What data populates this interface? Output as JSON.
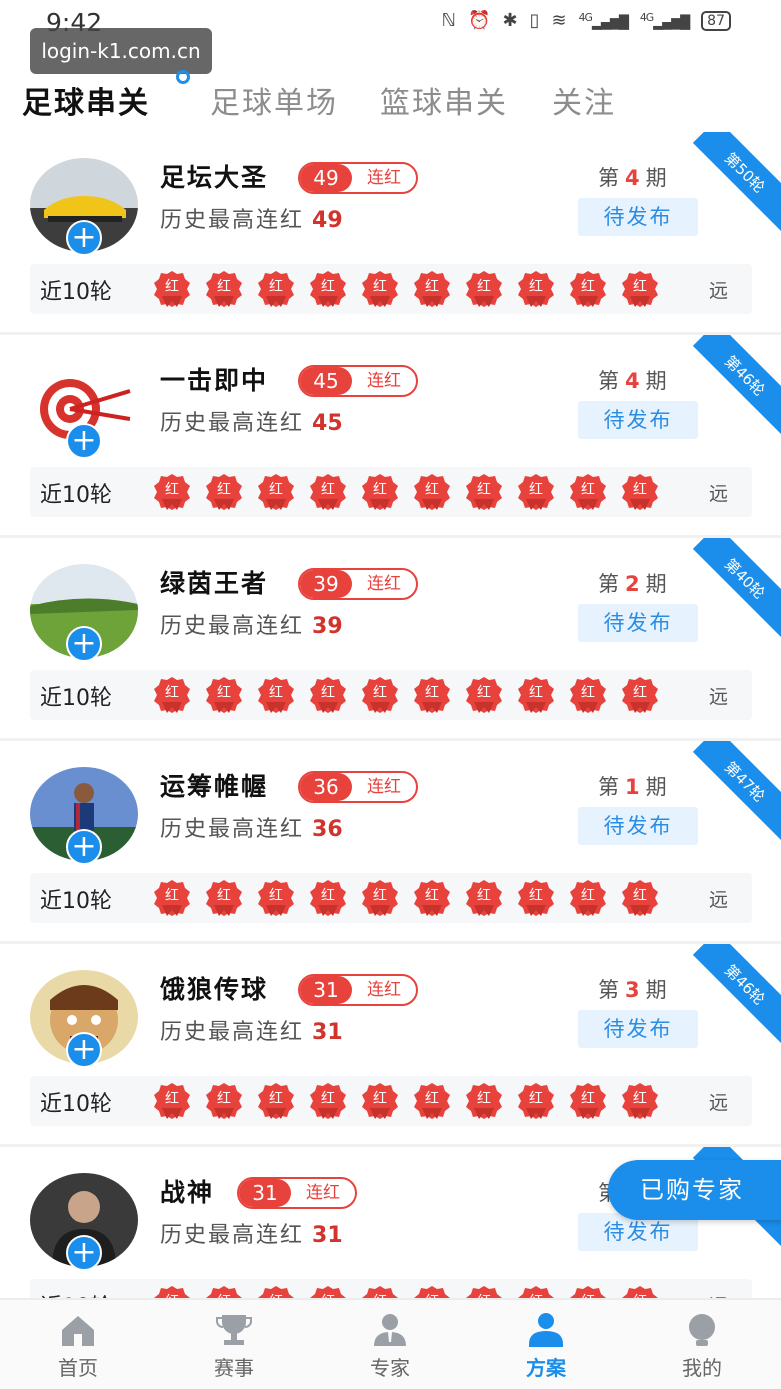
{
  "status_bar": {
    "time": "9:42",
    "battery": "87",
    "net1": "4G",
    "net2": "4G"
  },
  "watermark": "login-k1.com.cn",
  "tabs": [
    {
      "label": "足球串关",
      "active": true
    },
    {
      "label": "足球单场",
      "active": false
    },
    {
      "label": "篮球串关",
      "active": false
    },
    {
      "label": "关注",
      "active": false
    }
  ],
  "card_labels": {
    "history_prefix": "历史最高连红",
    "streak_suffix": "连红",
    "issue_prefix": "第",
    "issue_suffix": "期",
    "pending": "待发布",
    "recent_label": "近10轮",
    "badge_text": "红",
    "far_label": "远"
  },
  "experts": [
    {
      "name": "足坛大圣",
      "streak": "49",
      "history": "49",
      "issue": "4",
      "round": "第50轮",
      "avatar": "car-avatar"
    },
    {
      "name": "一击即中",
      "streak": "45",
      "history": "45",
      "issue": "4",
      "round": "第46轮",
      "avatar": "target-avatar"
    },
    {
      "name": "绿茵王者",
      "streak": "39",
      "history": "39",
      "issue": "2",
      "round": "第40轮",
      "avatar": "grassland-avatar"
    },
    {
      "name": "运筹帷幄",
      "streak": "36",
      "history": "36",
      "issue": "1",
      "round": "第47轮",
      "avatar": "player-avatar"
    },
    {
      "name": "饿狼传球",
      "streak": "31",
      "history": "31",
      "issue": "3",
      "round": "第46轮",
      "avatar": "face-avatar"
    },
    {
      "name": "战神",
      "streak": "31",
      "history": "31",
      "issue": "",
      "round": "",
      "avatar": "man-avatar"
    }
  ],
  "float_button": "已购专家",
  "bottom_nav": [
    {
      "label": "首页",
      "icon": "home-icon",
      "active": false
    },
    {
      "label": "赛事",
      "icon": "trophy-icon",
      "active": false
    },
    {
      "label": "专家",
      "icon": "expert-icon",
      "active": false
    },
    {
      "label": "方案",
      "icon": "plan-icon",
      "active": true
    },
    {
      "label": "我的",
      "icon": "profile-icon",
      "active": false
    }
  ],
  "colors": {
    "accent": "#1a8eea",
    "red": "#e8423d",
    "pending_bg": "#e6f2fd"
  }
}
